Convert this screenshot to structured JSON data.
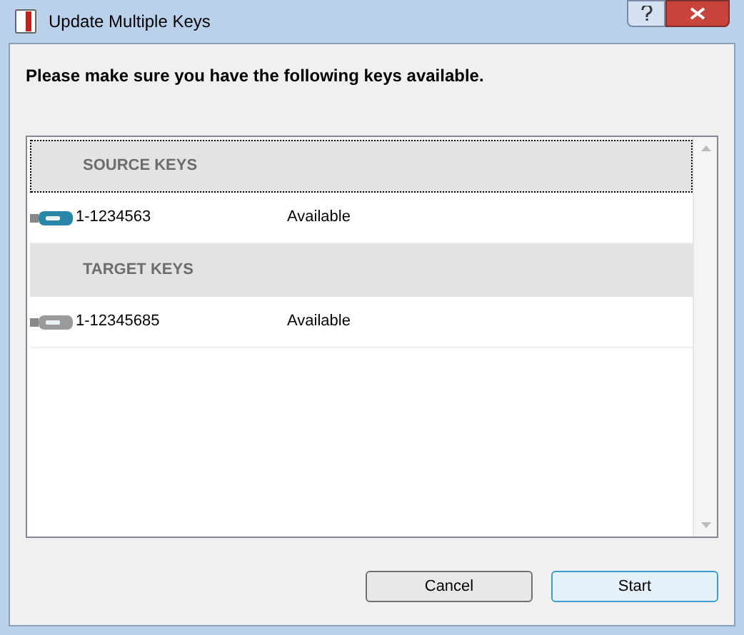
{
  "window": {
    "title": "Update Multiple Keys"
  },
  "instruction": "Please make sure you have the following keys available.",
  "list": {
    "rows": [
      {
        "kind": "group",
        "label": "SOURCE KEYS",
        "selected": true
      },
      {
        "kind": "key",
        "label": "1-1234563",
        "status": "Available",
        "color": "#2a86a6"
      },
      {
        "kind": "group",
        "label": "TARGET KEYS",
        "selected": false
      },
      {
        "kind": "key",
        "label": "1-12345685",
        "status": "Available",
        "color": "#9a9a9a"
      }
    ]
  },
  "buttons": [
    {
      "label": "Cancel",
      "default": false
    },
    {
      "label": "Start",
      "default": true
    }
  ]
}
